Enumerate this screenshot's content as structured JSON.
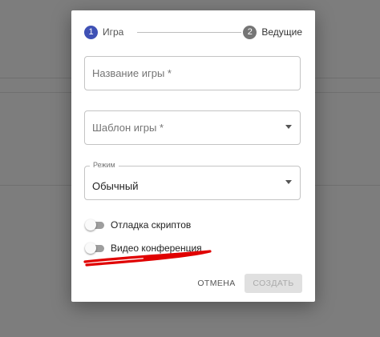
{
  "stepper": {
    "steps": [
      {
        "number": "1",
        "label": "Игра",
        "active": true
      },
      {
        "number": "2",
        "label": "Ведущие",
        "active": false
      }
    ]
  },
  "form": {
    "game_name": {
      "placeholder": "Название игры *"
    },
    "template": {
      "placeholder": "Шаблон игры *"
    },
    "mode": {
      "label": "Режим",
      "value": "Обычный"
    }
  },
  "toggles": [
    {
      "label": "Отладка скриптов",
      "on": false
    },
    {
      "label": "Видео конференция",
      "on": false
    }
  ],
  "actions": {
    "cancel_label": "ОТМЕНА",
    "create_label": "СОЗДАТЬ",
    "create_disabled": true
  },
  "colors": {
    "primary": "#3f51b5",
    "inactive_step": "#757575",
    "annotation": "#e00000"
  }
}
